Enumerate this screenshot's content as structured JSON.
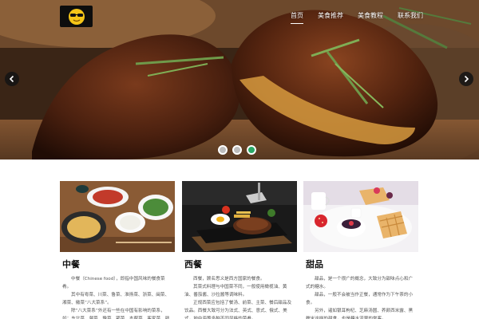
{
  "header": {
    "logo_icon": "sunglasses-emoji-icon",
    "nav": [
      {
        "label": "首页",
        "active": true
      },
      {
        "label": "美食推荐",
        "active": false
      },
      {
        "label": "美食教程",
        "active": false
      },
      {
        "label": "联系我们",
        "active": false
      }
    ]
  },
  "carousel": {
    "prev_icon": "chevron-left-icon",
    "next_icon": "chevron-right-icon",
    "dots": 3,
    "active_dot": 3,
    "active_color": "#2aa866"
  },
  "cards": [
    {
      "title": "中餐",
      "paragraphs": [
        "中餐（Chinese food），即指中国风味的餐食菜肴。",
        "其中有粤菜、川菜、鲁菜、淮扬菜、浙菜、闽菜、湘菜、徽菜“八大菜系”。",
        "除“八大菜系”外还有一些在中国有影响的菜系，如：东北菜、冀菜、豫菜、鄂菜、本帮菜、客家菜、赣菜、京菜、清真菜等菜系。"
      ]
    },
    {
      "title": "西餐",
      "paragraphs": [
        "西餐，顾名思义是西方国家的餐食。",
        "其菜式料理与中国菜不同，一般使用橄榄油、黄油、番茄酱、沙拉酱等调味料。",
        "正规西菜应包括了餐汤、前菜、主菜、餐后甜品及饮品。西餐大致可分为法式、英式、意式、俄式、美式，地中海等多种不同风格的菜肴。"
      ]
    },
    {
      "title": "甜品",
      "paragraphs": [
        "甜品，是一个很广的概念，大致分为甜味点心和广式的糖水。",
        "甜品，一般不会被当作正餐，通常作为下午茶的小食。",
        "另外，诸如银耳枸杞、芝麻汤圆、养颜西米露、黑糯米这样的甜食，也是糖水流里的常客。"
      ]
    }
  ]
}
